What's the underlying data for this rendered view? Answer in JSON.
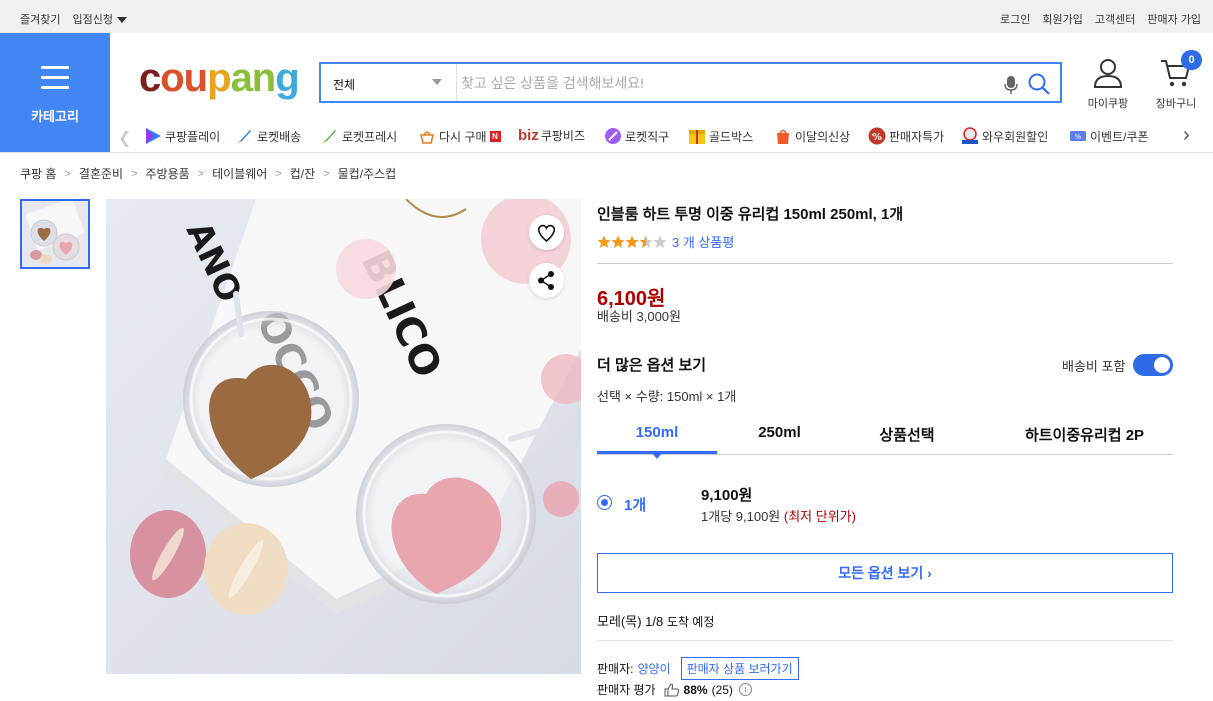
{
  "topbar": {
    "favorites": "즐겨찾기",
    "store_apply": "입점신청",
    "login": "로그인",
    "signup": "회원가입",
    "support": "고객센터",
    "seller_join": "판매자 가입"
  },
  "category_menu": {
    "label": "카테고리"
  },
  "logo": {
    "parts": [
      "c",
      "ou",
      "p",
      "an",
      "g"
    ]
  },
  "search": {
    "scope": "전체",
    "placeholder": "찾고 싶은 상품을 검색해보세요!"
  },
  "header": {
    "my_coupang": "마이쿠팡",
    "cart": "장바구니",
    "cart_count": "0"
  },
  "catnav": {
    "items": [
      {
        "label": "쿠팡플레이",
        "icon": "coupang-play-icon"
      },
      {
        "label": "로켓배송",
        "icon": "rocket-icon"
      },
      {
        "label": "로켓프레시",
        "icon": "rocket-fresh-icon"
      },
      {
        "label": "다시 구매",
        "icon": "rebuy-icon"
      },
      {
        "label": "쿠팡비즈",
        "prefix": "biz",
        "icon": "biz-icon"
      },
      {
        "label": "로켓직구",
        "icon": "rocket-global-icon"
      },
      {
        "label": "골드박스",
        "icon": "goldbox-icon"
      },
      {
        "label": "이달의신상",
        "icon": "new-icon"
      },
      {
        "label": "판매자특가",
        "icon": "percent-icon"
      },
      {
        "label": "와우회원할인",
        "icon": "wow-icon"
      },
      {
        "label": "이벤트/쿠폰",
        "icon": "coupon-icon"
      }
    ]
  },
  "breadcrumb": [
    "쿠팡 홈",
    "결혼준비",
    "주방용품",
    "테이블웨어",
    "컵/잔",
    "물컵/주스컵"
  ],
  "product": {
    "title": "인블룸 하트 투명 이중 유리컵 150ml 250ml, 1개",
    "rating": 3.5,
    "review_count": "3 개 상품평",
    "price": "6,100원",
    "shipping": "배송비 3,000원",
    "more_options": "더 많은 옵션 보기",
    "shipping_included": "배송비 포함",
    "shipping_included_on": true,
    "selected": "선택 × 수량: 150ml × 1개",
    "tabs": [
      "150ml",
      "250ml",
      "상품선택",
      "하트이중유리컵 2P"
    ],
    "option": {
      "qty": "1개",
      "price": "9,100원",
      "unit_price": "1개당 9,100원",
      "lowest": "(최저 단위가)"
    },
    "all_options": "모든 옵션 보기",
    "arrival": "모레(목) 1/8",
    "arrival_suffix": "도착 예정",
    "seller_label": "판매자:",
    "seller_name": "양양이",
    "seller_link": "판매자 상품 보러가기",
    "seller_rating_label": "판매자 평가",
    "seller_rating_pct": "88%",
    "seller_rating_count": "(25)"
  },
  "colors": {
    "accent": "#346aff",
    "brand_blue": "#4285f4",
    "price_red": "#ae0000"
  }
}
